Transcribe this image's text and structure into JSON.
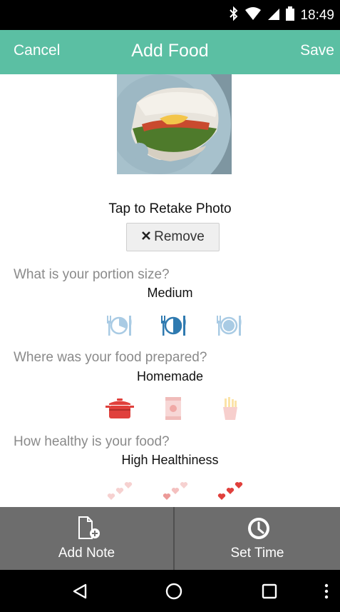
{
  "status_bar": {
    "time": "18:49"
  },
  "header": {
    "cancel_label": "Cancel",
    "title": "Add Food",
    "save_label": "Save"
  },
  "photo": {
    "retake_label": "Tap to Retake Photo",
    "remove_label": "Remove"
  },
  "portion": {
    "question": "What is your portion size?",
    "answer": "Medium",
    "options": [
      "small-plate-icon",
      "medium-plate-icon",
      "large-plate-icon"
    ],
    "selected_index": 1
  },
  "prepared": {
    "question": "Where was your food prepared?",
    "answer": "Homemade",
    "options": [
      "pot-icon",
      "can-icon",
      "fries-icon"
    ],
    "selected_index": 0
  },
  "healthy": {
    "question": "How healthy is your food?",
    "answer": "High Healthiness",
    "options": [
      "hearts-low-icon",
      "hearts-medium-icon",
      "hearts-high-icon"
    ],
    "selected_index": 2
  },
  "bottom_bar": {
    "add_note_label": "Add Note",
    "set_time_label": "Set Time"
  },
  "colors": {
    "accent": "#5bbfa3",
    "plate_selected": "#2f7ab0",
    "plate_dim": "#a9cbe4",
    "pot": "#e0403c",
    "heart": "#e0403c"
  }
}
